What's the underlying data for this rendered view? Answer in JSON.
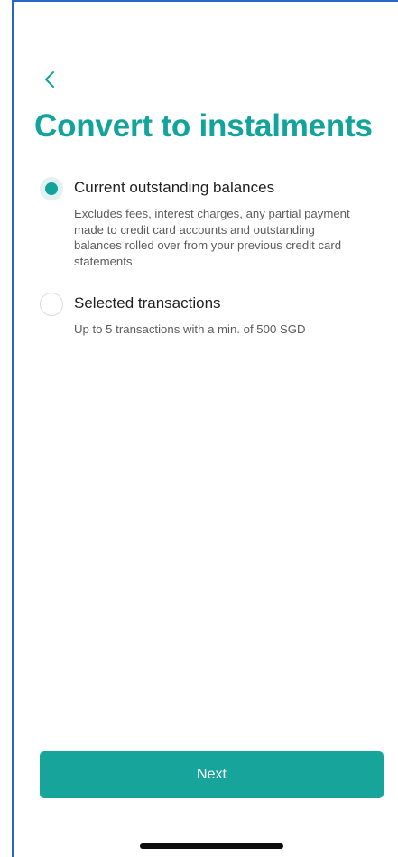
{
  "header": {
    "back_icon": "chevron-left-icon",
    "title": "Convert to instalments"
  },
  "options": [
    {
      "label": "Current outstanding balances",
      "description": "Excludes fees, interest charges, any partial payment made to credit card accounts and outstanding balances rolled over from your previous credit card statements",
      "selected": true
    },
    {
      "label": "Selected transactions",
      "description": "Up to 5 transactions with a min. of 500 SGD",
      "selected": false
    }
  ],
  "footer": {
    "next_label": "Next"
  },
  "colors": {
    "accent": "#12a39a",
    "button": "#17a59b",
    "radio_selected_bg": "#e2f2f1",
    "frame_border": "#2a67c8"
  }
}
